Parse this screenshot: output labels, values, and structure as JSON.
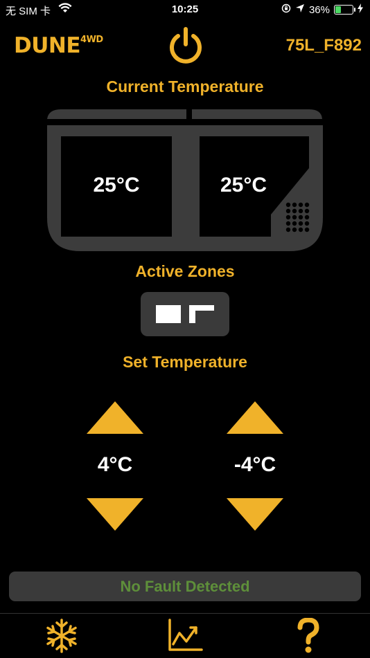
{
  "status_bar": {
    "carrier": "无 SIM 卡",
    "time": "10:25",
    "battery_percent": "36%",
    "battery_level": 0.36
  },
  "header": {
    "brand_main": "DUNE",
    "brand_sup": "4WD",
    "device_name": "75L_F892"
  },
  "current_temperature": {
    "heading": "Current Temperature",
    "left_zone": "25°C",
    "right_zone": "25°C"
  },
  "active_zones": {
    "heading": "Active Zones"
  },
  "set_temperature": {
    "heading": "Set Temperature",
    "left_zone": "4°C",
    "right_zone": "-4°C"
  },
  "fault": {
    "message": "No Fault Detected"
  },
  "colors": {
    "accent": "#f0b22a",
    "panel": "#3a3a3a",
    "ok_text": "#5e8f3a"
  },
  "tabs": [
    {
      "icon": "snowflake-icon"
    },
    {
      "icon": "chart-icon"
    },
    {
      "icon": "help-icon"
    }
  ]
}
